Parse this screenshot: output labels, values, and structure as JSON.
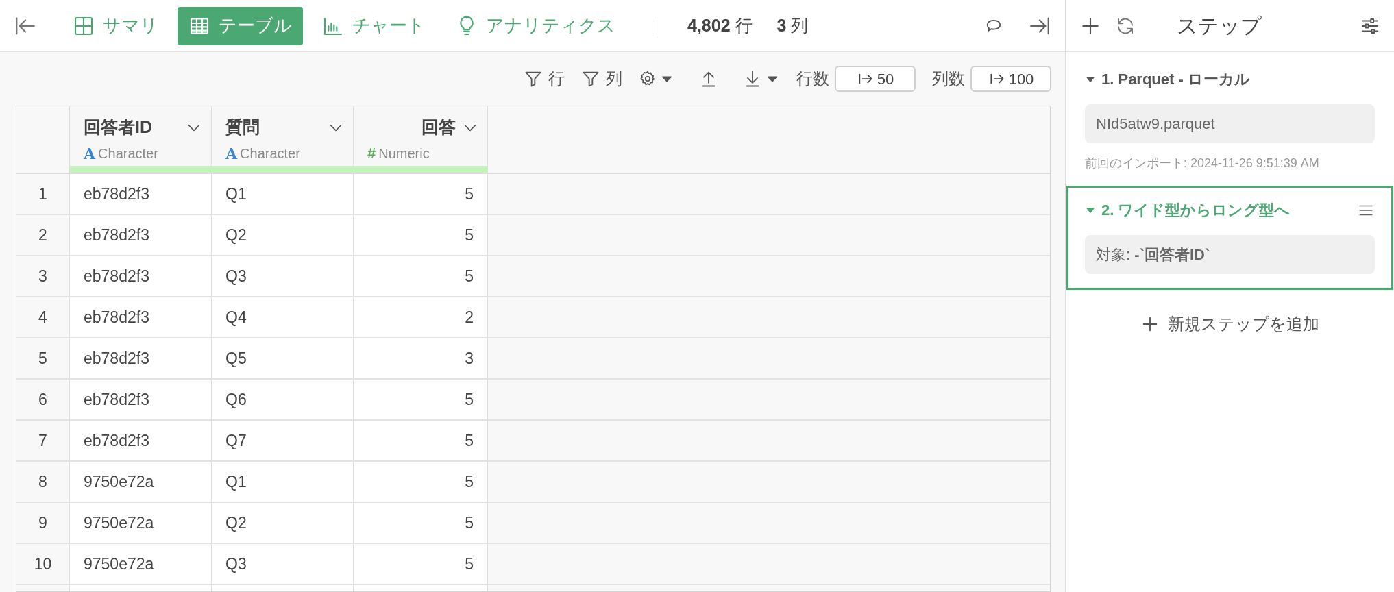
{
  "top_bar": {
    "tabs": [
      {
        "kind": "summary",
        "label": "サマリ",
        "selected": false
      },
      {
        "kind": "table",
        "label": "テーブル",
        "selected": true
      },
      {
        "kind": "chart",
        "label": "チャート",
        "selected": false
      },
      {
        "kind": "analytics",
        "label": "アナリティクス",
        "selected": false
      }
    ],
    "row_count": "4,802",
    "row_unit": "行",
    "col_count": "3",
    "col_unit": "列"
  },
  "toolbar": {
    "row_filter": "行",
    "col_filter": "列",
    "rows_label": "行数",
    "rows_value": "50",
    "cols_label": "列数",
    "cols_value": "100"
  },
  "table": {
    "columns": [
      {
        "name": "回答者ID",
        "type_icon": "A",
        "type": "Character",
        "kind": "character"
      },
      {
        "name": "質問",
        "type_icon": "A",
        "type": "Character",
        "kind": "character"
      },
      {
        "name": "回答",
        "type_icon": "#",
        "type": "Numeric",
        "kind": "numeric"
      }
    ],
    "rows": [
      {
        "index": "1",
        "cells": [
          "eb78d2f3",
          "Q1",
          "5"
        ]
      },
      {
        "index": "2",
        "cells": [
          "eb78d2f3",
          "Q2",
          "5"
        ]
      },
      {
        "index": "3",
        "cells": [
          "eb78d2f3",
          "Q3",
          "5"
        ]
      },
      {
        "index": "4",
        "cells": [
          "eb78d2f3",
          "Q4",
          "2"
        ]
      },
      {
        "index": "5",
        "cells": [
          "eb78d2f3",
          "Q5",
          "3"
        ]
      },
      {
        "index": "6",
        "cells": [
          "eb78d2f3",
          "Q6",
          "5"
        ]
      },
      {
        "index": "7",
        "cells": [
          "eb78d2f3",
          "Q7",
          "5"
        ]
      },
      {
        "index": "8",
        "cells": [
          "9750e72a",
          "Q1",
          "5"
        ]
      },
      {
        "index": "9",
        "cells": [
          "9750e72a",
          "Q2",
          "5"
        ]
      },
      {
        "index": "10",
        "cells": [
          "9750e72a",
          "Q3",
          "5"
        ]
      }
    ]
  },
  "steps_panel": {
    "title": "ステップ",
    "steps": [
      {
        "title": "1. Parquet - ローカル",
        "selected": false,
        "expanded": true,
        "detail": "NId5atw9.parquet",
        "note": "前回のインポート: 2024-11-26 9:51:39 AM"
      },
      {
        "title": "2. ワイド型からロング型へ",
        "selected": true,
        "expanded": true,
        "detail": "対象: **-`回答者ID`**"
      }
    ],
    "add_step": "新規ステップを追加"
  }
}
